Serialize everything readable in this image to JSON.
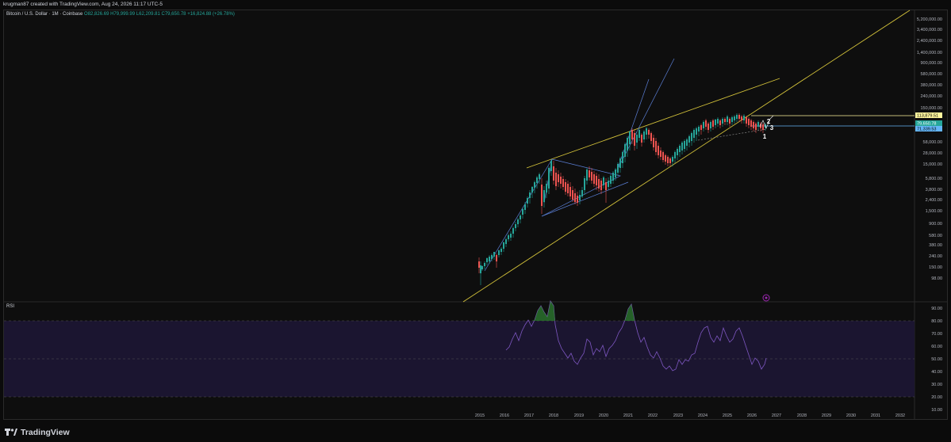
{
  "header": {
    "caption": "krugman87 created with TradingView.com, Aug 24, 2026 11:17 UTC-5"
  },
  "legend": {
    "symbol": "Bitcoin / U.S. Dollar · 1M · Coinbase",
    "open": "O82,826.69",
    "high": "H79,999.99",
    "low": "L62,209.81",
    "close": "C79,650.78",
    "change": "+16,824.88 (+26.78%)"
  },
  "price_axis": {
    "ticks": [
      "5,200,000.00",
      "3,400,000.00",
      "2,400,000.00",
      "1,400,000.00",
      "900,000.00",
      "580,000.00",
      "380,000.00",
      "240,000.00",
      "150,000.00",
      "58,000.00",
      "28,000.00",
      "15,000.00",
      "5,800.00",
      "3,800.00",
      "2,400.00",
      "1,500.00",
      "900.00",
      "580.00",
      "380.00",
      "240.00",
      "150.00",
      "98.00"
    ],
    "badges": [
      {
        "text": "113,879.51",
        "bg": "#fff59d",
        "fg": "#000000"
      },
      {
        "text": "79,650.78",
        "bg": "#26a69a",
        "fg": "#ffffff"
      },
      {
        "text": "71,339.53",
        "bg": "#64b5f6",
        "fg": "#000000"
      }
    ]
  },
  "rsi": {
    "label": "RSI",
    "ticks": [
      "90.00",
      "80.00",
      "70.00",
      "60.00",
      "50.00",
      "40.00",
      "30.00",
      "20.00",
      "10.00"
    ]
  },
  "time_axis": {
    "years": [
      "2015",
      "2016",
      "2017",
      "2018",
      "2019",
      "2020",
      "2021",
      "2022",
      "2023",
      "2024",
      "2025",
      "2026",
      "2027",
      "2028",
      "2029",
      "2030",
      "2031",
      "2032"
    ]
  },
  "annotations": {
    "wave_labels": [
      "2",
      "3",
      "1"
    ]
  },
  "brand": {
    "name": "TradingView"
  },
  "colors": {
    "up": "#26a69a",
    "down": "#ef5350",
    "trendline_yellow": "#d4c33a",
    "trendline_blue": "#5b7fd6",
    "rsi_line": "#7e57c2",
    "rsi_band": "#1b1530"
  }
}
